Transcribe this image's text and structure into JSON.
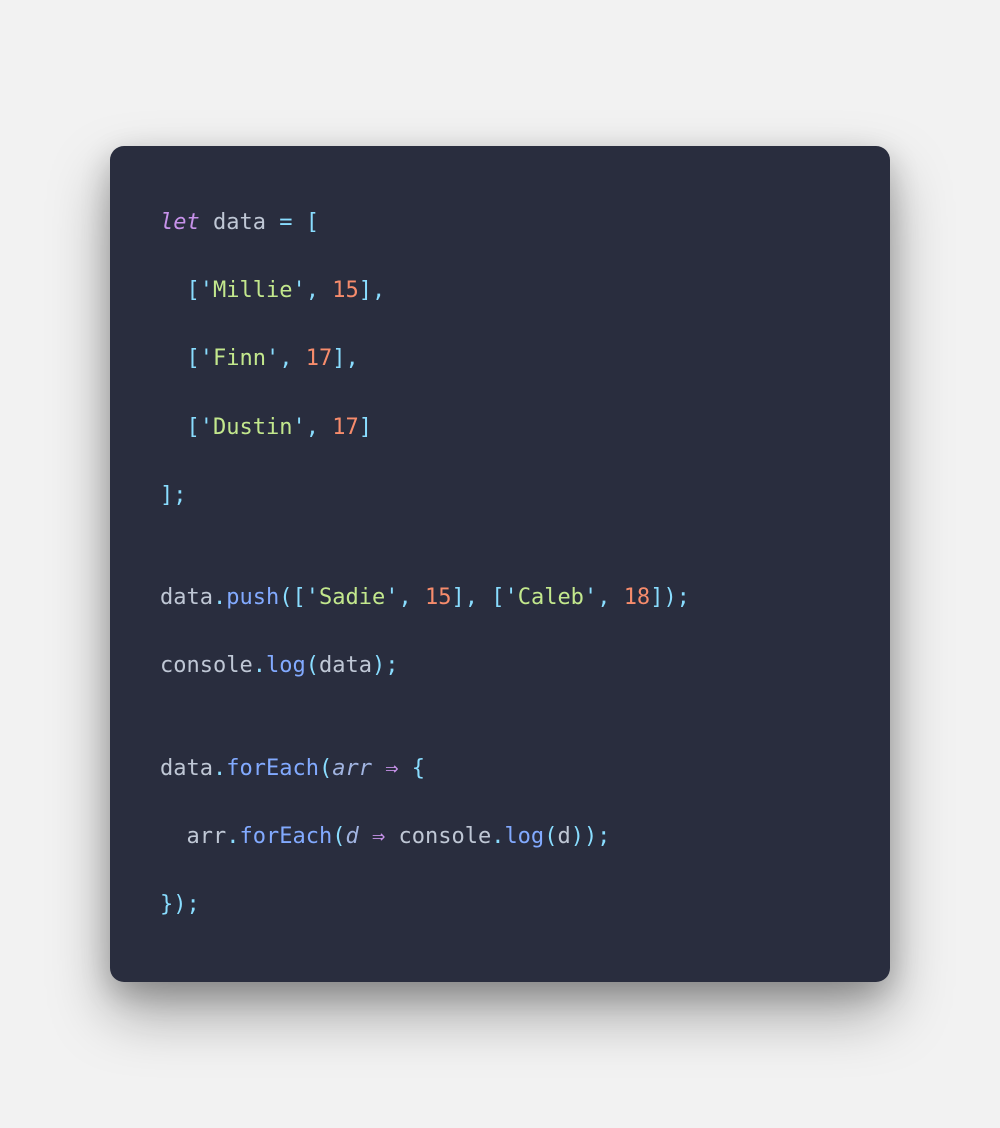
{
  "code": {
    "l1": {
      "kw": "let",
      "sp1": " ",
      "id": "data",
      "sp2": " ",
      "eq": "=",
      "sp3": " ",
      "br": "["
    },
    "l2": {
      "indent": "  ",
      "lb": "[",
      "q1": "'",
      "s": "Millie",
      "q2": "'",
      "c1": ",",
      "sp": " ",
      "n": "15",
      "rb": "]",
      "c2": ","
    },
    "l3": {
      "indent": "  ",
      "lb": "[",
      "q1": "'",
      "s": "Finn",
      "q2": "'",
      "c1": ",",
      "sp": " ",
      "n": "17",
      "rb": "]",
      "c2": ","
    },
    "l4": {
      "indent": "  ",
      "lb": "[",
      "q1": "'",
      "s": "Dustin",
      "q2": "'",
      "c1": ",",
      "sp": " ",
      "n": "17",
      "rb": "]"
    },
    "l5": {
      "rb": "];"
    },
    "l6": {
      "obj": "data",
      "dot": ".",
      "fn": "push",
      "op": "(",
      "lb1": "[",
      "q1": "'",
      "s1": "Sadie",
      "q2": "'",
      "c1": ",",
      "sp1": " ",
      "n1": "15",
      "rb1": "]",
      "c2": ",",
      "sp2": " ",
      "lb2": "[",
      "q3": "'",
      "s2": "Caleb",
      "q4": "'",
      "c3": ",",
      "sp3": " ",
      "n2": "18",
      "rb2": "]",
      "cp": ");"
    },
    "l7": {
      "obj": "console",
      "dot": ".",
      "fn": "log",
      "op": "(",
      "arg": "data",
      "cp": ");"
    },
    "l8": {
      "obj": "data",
      "dot": ".",
      "fn": "forEach",
      "op": "(",
      "param": "arr",
      "sp1": " ",
      "arrow": "⇒",
      "sp2": " ",
      "brace": "{"
    },
    "l9": {
      "indent": "  ",
      "obj": "arr",
      "dot": ".",
      "fn": "forEach",
      "op": "(",
      "param": "d",
      "sp1": " ",
      "arrow": "⇒",
      "sp2": " ",
      "obj2": "console",
      "dot2": ".",
      "fn2": "log",
      "op2": "(",
      "arg": "d",
      "cp2": ")",
      "cp": ");"
    },
    "l10": {
      "close": "});"
    }
  }
}
